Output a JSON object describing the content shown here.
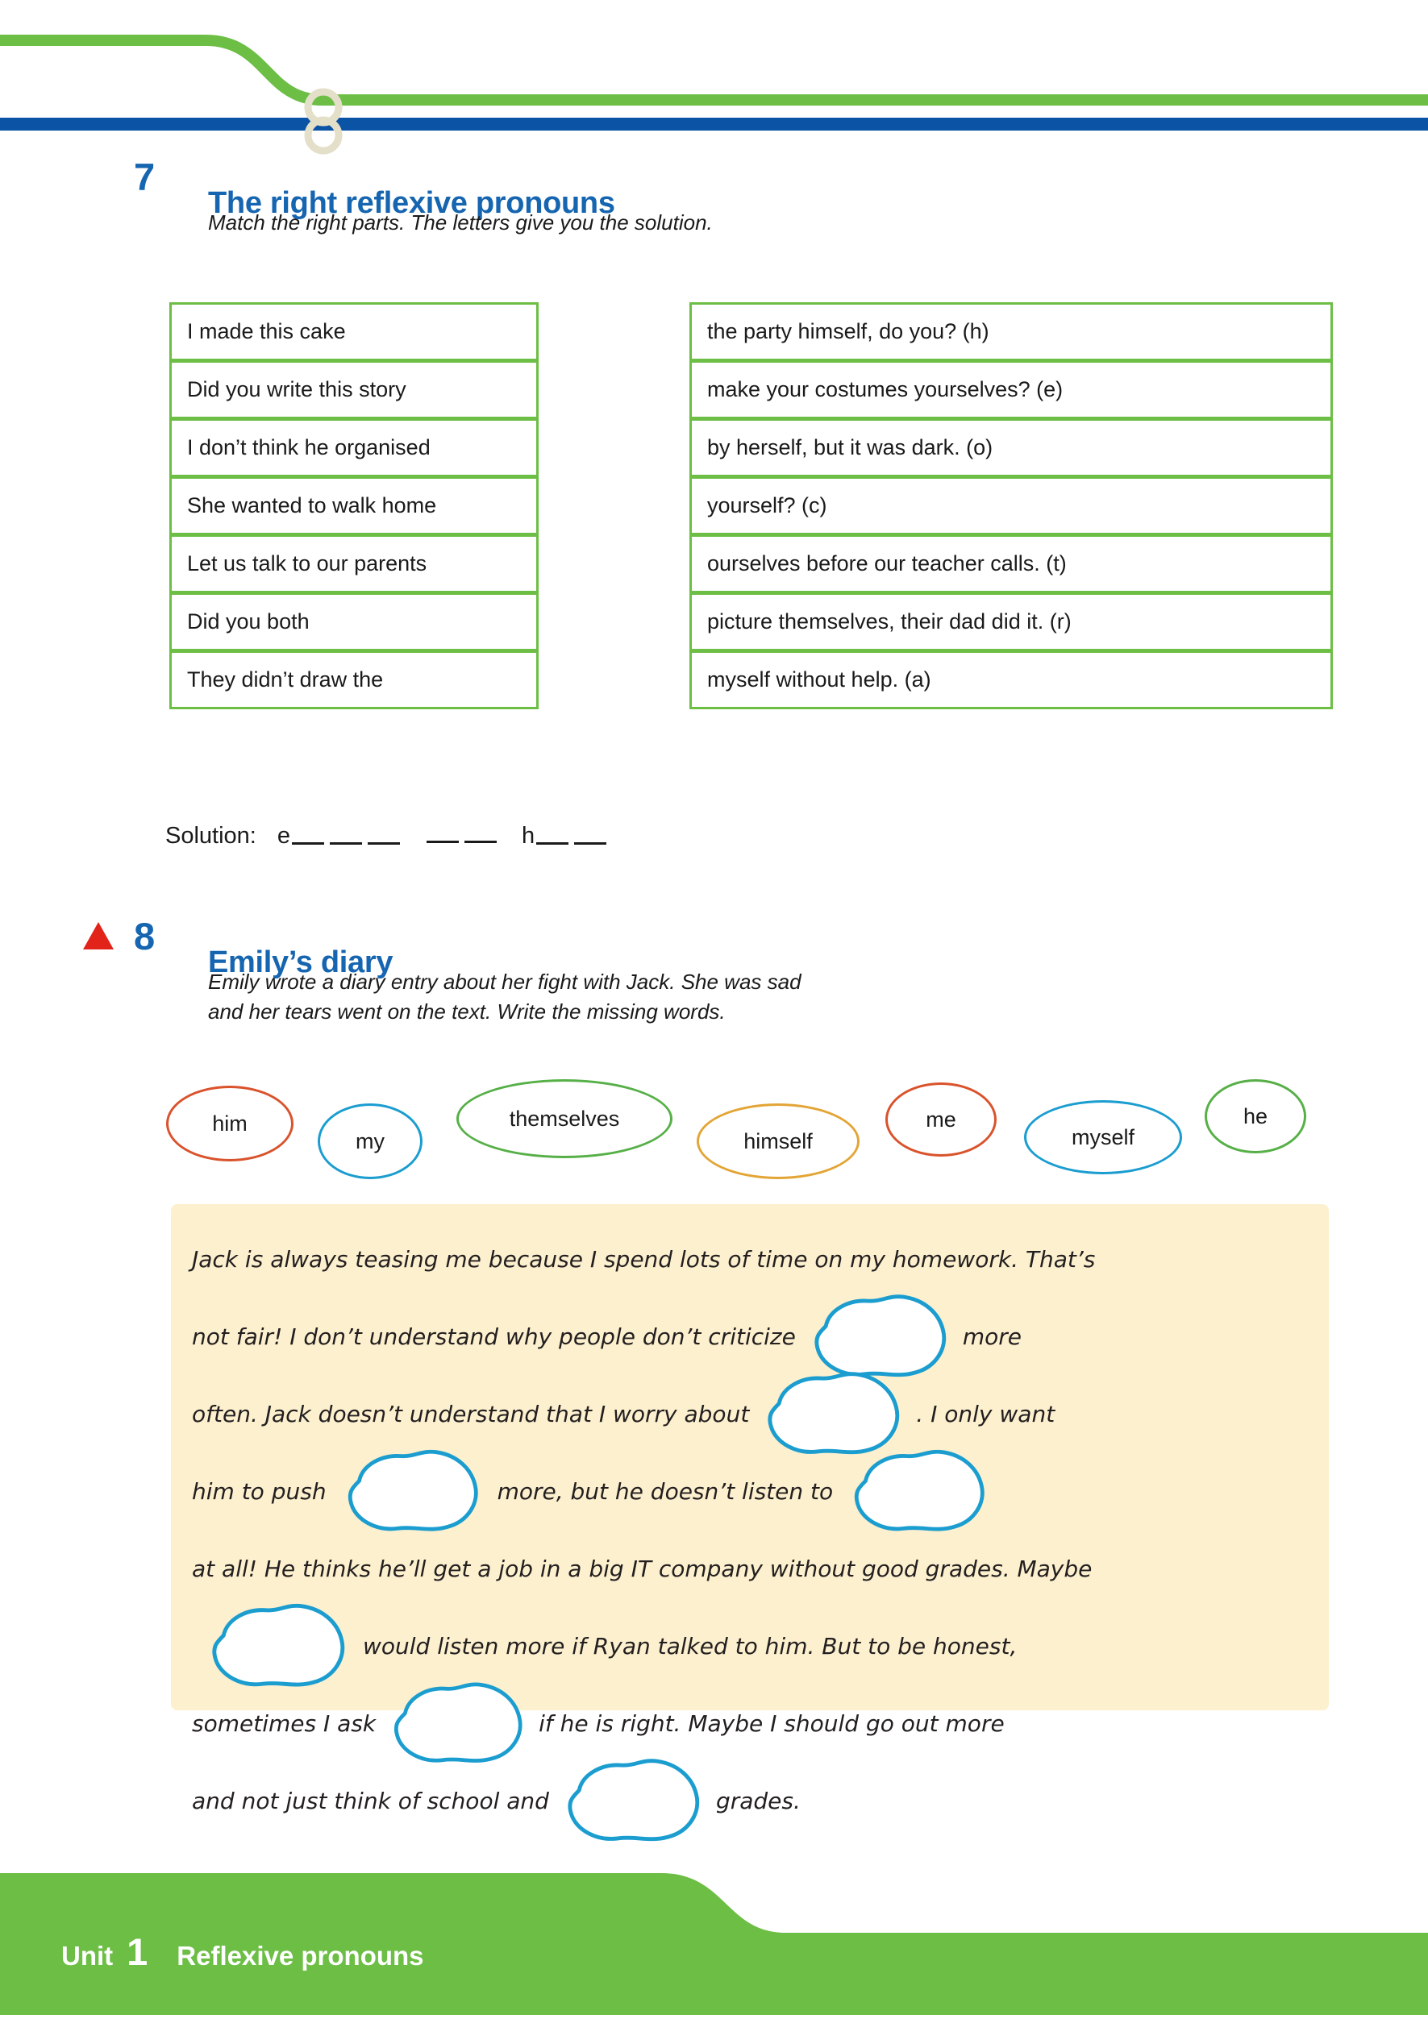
{
  "header": {
    "spiral_icon": "spiral-binding-ring",
    "green_color": "#6cbe45",
    "blue_color": "#0b53a4"
  },
  "exercise7": {
    "number": "7",
    "title": "The right reflexive pronouns",
    "instruction": "Match the right parts. The letters give you the solution.",
    "left_items": [
      "I made this cake",
      "Did you write this story",
      "I don’t think he organised",
      "She wanted to walk home",
      "Let us talk to our parents",
      "Did you both",
      "They didn’t draw the"
    ],
    "right_items": [
      "the party himself, do you? (h)",
      "make your costumes yourselves? (e)",
      "by herself, but it was dark. (o)",
      "yourself? (c)",
      "ourselves before our teacher calls. (t)",
      "picture themselves, their dad did it. (r)",
      "myself without help. (a)"
    ],
    "solution_label": "Solution:",
    "solution_prefilled": [
      {
        "letter": "e",
        "blanks": 3
      },
      {
        "letter": "",
        "blanks": 2
      },
      {
        "letter": "h",
        "blanks": 2
      }
    ]
  },
  "exercise8": {
    "marker": "red-triangle",
    "number": "8",
    "title": "Emily’s diary",
    "instruction": "Emily wrote a diary entry about her fight with Jack. She was sad\nand her tears went on the text. Write the missing words.",
    "word_bank": [
      {
        "label": "him",
        "color": "#d9532c"
      },
      {
        "label": "my",
        "color": "#1b9dd0"
      },
      {
        "label": "themselves",
        "color": "#56b047"
      },
      {
        "label": "himself",
        "color": "#e3a535"
      },
      {
        "label": "me",
        "color": "#d9532c"
      },
      {
        "label": "myself",
        "color": "#1b9dd0"
      },
      {
        "label": "he",
        "color": "#56b047"
      }
    ],
    "diary_lines": [
      {
        "before": "Jack is always teasing me because I spend lots of time on my homework. That’s",
        "blob": false,
        "after": ""
      },
      {
        "before": "not fair! I don’t understand why people don’t criticize",
        "blob": true,
        "after": "more"
      },
      {
        "before": "often. Jack doesn’t understand that I worry about",
        "blob": true,
        "after": ". I only want"
      },
      {
        "before": "him to push",
        "blob": true,
        "after": "more, but he doesn’t listen to",
        "blob2": true
      },
      {
        "before": "at all! He thinks he’ll get a job in a big IT company without good grades. Maybe",
        "blob": false,
        "after": ""
      },
      {
        "before": "",
        "blob": true,
        "after": "would listen more if Ryan talked to him. But to be honest,"
      },
      {
        "before": "sometimes I ask",
        "blob": true,
        "after": "if he is right. Maybe I should go out more"
      },
      {
        "before": "and not just think of school and",
        "blob": true,
        "after": "grades."
      }
    ],
    "blob_color": "#1b9dd0",
    "panel_color": "#fcf0ce"
  },
  "footer": {
    "unit_label": "Unit",
    "unit_number": "1",
    "title": "Reflexive pronouns",
    "color": "#6cbe45"
  }
}
